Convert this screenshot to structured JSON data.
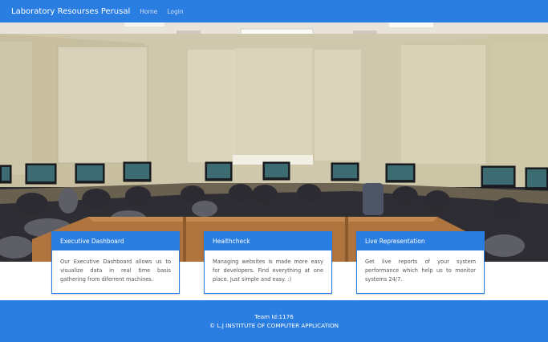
{
  "navbar": {
    "brand": "Laboratory Resourses Perusal",
    "links": [
      "Home",
      "Login"
    ]
  },
  "hero": {
    "image_description_icon": "computer-lab-photo"
  },
  "cards": [
    {
      "title": "Executive Dashboard",
      "text": "Our Executive Dashboard allows us to visualize data in real time basis gathering from diferrent machines."
    },
    {
      "title": "Healthcheck",
      "text": "Managing websites is made more easy for developers. Find everything at one place. Just simple and easy. :)"
    },
    {
      "title": "Live Representation",
      "text": "Get live reports of your system performance which help us to monitor systems 24/7."
    }
  ],
  "footer": {
    "team": "Team Id:1176",
    "copyright": "© L.J INSTITUTE OF COMPUTER APPLICATION"
  },
  "colors": {
    "primary": "#2a7de1",
    "white": "#ffffff"
  }
}
